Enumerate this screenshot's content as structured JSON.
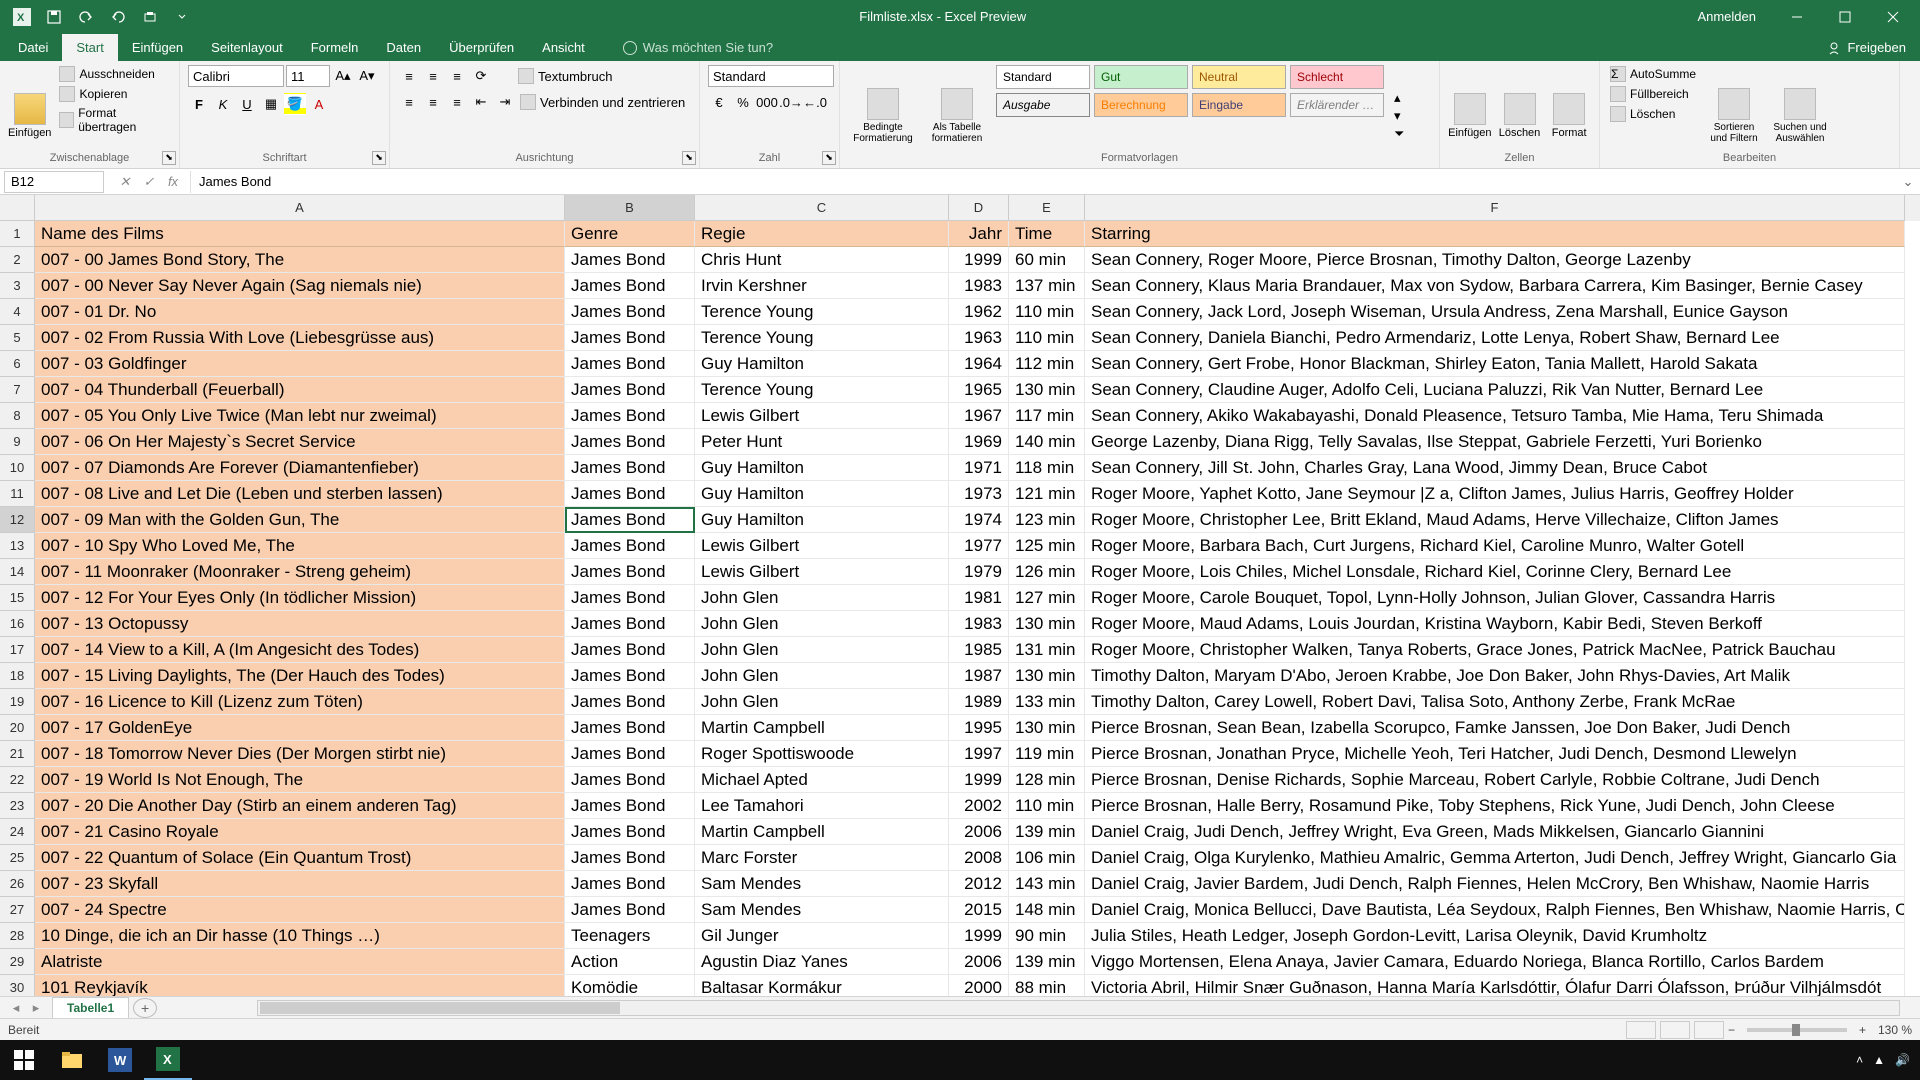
{
  "window": {
    "title": "Filmliste.xlsx - Excel Preview",
    "anmelden": "Anmelden"
  },
  "tabs": {
    "datei": "Datei",
    "start": "Start",
    "einfuegen": "Einfügen",
    "seitenlayout": "Seitenlayout",
    "formeln": "Formeln",
    "daten": "Daten",
    "ueberpruefen": "Überprüfen",
    "ansicht": "Ansicht",
    "tellme": "Was möchten Sie tun?",
    "freigeben": "Freigeben"
  },
  "ribbon": {
    "clipboard": {
      "label": "Zwischenablage",
      "paste": "Einfügen",
      "cut": "Ausschneiden",
      "copy": "Kopieren",
      "formatpainter": "Format übertragen"
    },
    "font": {
      "label": "Schriftart",
      "name": "Calibri",
      "size": "11"
    },
    "alignment": {
      "label": "Ausrichtung",
      "wrap": "Textumbruch",
      "merge": "Verbinden und zentrieren"
    },
    "number": {
      "label": "Zahl",
      "format": "Standard"
    },
    "styles": {
      "label": "Formatvorlagen",
      "conditional": "Bedingte Formatierung",
      "astable": "Als Tabelle formatieren",
      "standard": "Standard",
      "gut": "Gut",
      "neutral": "Neutral",
      "schlecht": "Schlecht",
      "ausgabe": "Ausgabe",
      "berechnung": "Berechnung",
      "eingabe": "Eingabe",
      "erklaerender": "Erklärender …"
    },
    "cells": {
      "label": "Zellen",
      "insert": "Einfügen",
      "delete": "Löschen",
      "format": "Format"
    },
    "editing": {
      "label": "Bearbeiten",
      "autosum": "AutoSumme",
      "fill": "Füllbereich",
      "clear": "Löschen",
      "sort": "Sortieren und Filtern",
      "find": "Suchen und Auswählen"
    }
  },
  "formula": {
    "namebox": "B12",
    "value": "James Bond"
  },
  "columns": [
    "A",
    "B",
    "C",
    "D",
    "E",
    "F"
  ],
  "headers": {
    "a": "Name des Films",
    "b": "Genre",
    "c": "Regie",
    "d": "Jahr",
    "e": "Time",
    "f": "Starring"
  },
  "rows": [
    {
      "n": 2,
      "a": "007 - 00 James Bond Story, The",
      "b": "James Bond",
      "c": "Chris Hunt",
      "d": "1999",
      "e": "60 min",
      "f": "Sean Connery, Roger Moore, Pierce Brosnan, Timothy Dalton, George Lazenby"
    },
    {
      "n": 3,
      "a": "007 - 00 Never Say Never Again (Sag niemals nie)",
      "b": "James Bond",
      "c": "Irvin Kershner",
      "d": "1983",
      "e": "137 min",
      "f": "Sean Connery, Klaus Maria Brandauer, Max von Sydow, Barbara Carrera, Kim Basinger, Bernie Casey"
    },
    {
      "n": 4,
      "a": "007 - 01 Dr. No",
      "b": "James Bond",
      "c": "Terence Young",
      "d": "1962",
      "e": "110 min",
      "f": "Sean Connery, Jack Lord, Joseph Wiseman, Ursula Andress, Zena Marshall, Eunice Gayson"
    },
    {
      "n": 5,
      "a": "007 - 02 From Russia With Love (Liebesgrüsse aus)",
      "b": "James Bond",
      "c": "Terence Young",
      "d": "1963",
      "e": "110 min",
      "f": "Sean Connery, Daniela Bianchi, Pedro Armendariz, Lotte Lenya, Robert Shaw, Bernard Lee"
    },
    {
      "n": 6,
      "a": "007 - 03 Goldfinger",
      "b": "James Bond",
      "c": "Guy Hamilton",
      "d": "1964",
      "e": "112 min",
      "f": "Sean Connery, Gert Frobe, Honor Blackman, Shirley Eaton, Tania Mallett, Harold Sakata"
    },
    {
      "n": 7,
      "a": "007 - 04 Thunderball (Feuerball)",
      "b": "James Bond",
      "c": "Terence Young",
      "d": "1965",
      "e": "130 min",
      "f": "Sean Connery, Claudine Auger, Adolfo Celi, Luciana Paluzzi, Rik Van Nutter, Bernard Lee"
    },
    {
      "n": 8,
      "a": "007 - 05 You Only Live Twice (Man lebt nur zweimal)",
      "b": "James Bond",
      "c": "Lewis Gilbert",
      "d": "1967",
      "e": "117 min",
      "f": "Sean Connery, Akiko Wakabayashi, Donald Pleasence, Tetsuro Tamba, Mie Hama, Teru Shimada"
    },
    {
      "n": 9,
      "a": "007 - 06 On Her Majesty`s Secret Service",
      "b": "James Bond",
      "c": "Peter Hunt",
      "d": "1969",
      "e": "140 min",
      "f": "George Lazenby, Diana Rigg, Telly Savalas, Ilse Steppat, Gabriele Ferzetti, Yuri Borienko"
    },
    {
      "n": 10,
      "a": "007 - 07 Diamonds Are Forever (Diamantenfieber)",
      "b": "James Bond",
      "c": "Guy Hamilton",
      "d": "1971",
      "e": "118 min",
      "f": "Sean Connery, Jill St. John, Charles Gray, Lana Wood, Jimmy Dean, Bruce Cabot"
    },
    {
      "n": 11,
      "a": "007 - 08 Live and Let Die (Leben und sterben lassen)",
      "b": "James Bond",
      "c": "Guy Hamilton",
      "d": "1973",
      "e": "121 min",
      "f": "Roger Moore, Yaphet Kotto, Jane Seymour |Z a, Clifton James, Julius Harris, Geoffrey Holder"
    },
    {
      "n": 12,
      "a": "007 - 09 Man with the Golden Gun, The",
      "b": "James Bond",
      "c": "Guy Hamilton",
      "d": "1974",
      "e": "123 min",
      "f": "Roger Moore, Christopher Lee, Britt Ekland, Maud Adams, Herve Villechaize, Clifton James"
    },
    {
      "n": 13,
      "a": "007 - 10 Spy Who Loved Me, The",
      "b": "James Bond",
      "c": "Lewis Gilbert",
      "d": "1977",
      "e": "125 min",
      "f": "Roger Moore, Barbara Bach, Curt Jurgens, Richard Kiel, Caroline Munro, Walter Gotell"
    },
    {
      "n": 14,
      "a": "007 - 11 Moonraker (Moonraker - Streng geheim)",
      "b": "James Bond",
      "c": "Lewis Gilbert",
      "d": "1979",
      "e": "126 min",
      "f": "Roger Moore, Lois Chiles, Michel Lonsdale, Richard Kiel, Corinne Clery, Bernard Lee"
    },
    {
      "n": 15,
      "a": "007 - 12 For Your Eyes Only (In tödlicher Mission)",
      "b": "James Bond",
      "c": "John Glen",
      "d": "1981",
      "e": "127 min",
      "f": "Roger Moore, Carole Bouquet, Topol, Lynn-Holly Johnson, Julian Glover, Cassandra Harris"
    },
    {
      "n": 16,
      "a": "007 - 13 Octopussy",
      "b": "James Bond",
      "c": "John Glen",
      "d": "1983",
      "e": "130 min",
      "f": "Roger Moore, Maud Adams, Louis Jourdan, Kristina Wayborn, Kabir Bedi, Steven Berkoff"
    },
    {
      "n": 17,
      "a": "007 - 14 View to a Kill, A (Im Angesicht des Todes)",
      "b": "James Bond",
      "c": "John Glen",
      "d": "1985",
      "e": "131 min",
      "f": "Roger Moore, Christopher Walken, Tanya Roberts, Grace Jones, Patrick MacNee, Patrick Bauchau"
    },
    {
      "n": 18,
      "a": "007 - 15 Living Daylights, The (Der Hauch des Todes)",
      "b": "James Bond",
      "c": "John Glen",
      "d": "1987",
      "e": "130 min",
      "f": "Timothy Dalton, Maryam D'Abo, Jeroen Krabbe, Joe Don Baker, John Rhys-Davies, Art Malik"
    },
    {
      "n": 19,
      "a": "007 - 16 Licence to Kill (Lizenz zum Töten)",
      "b": "James Bond",
      "c": "John Glen",
      "d": "1989",
      "e": "133 min",
      "f": "Timothy Dalton, Carey Lowell, Robert Davi, Talisa Soto, Anthony Zerbe, Frank McRae"
    },
    {
      "n": 20,
      "a": "007 - 17 GoldenEye",
      "b": "James Bond",
      "c": "Martin Campbell",
      "d": "1995",
      "e": "130 min",
      "f": "Pierce Brosnan, Sean Bean, Izabella Scorupco, Famke Janssen, Joe Don Baker, Judi Dench"
    },
    {
      "n": 21,
      "a": "007 - 18 Tomorrow Never Dies (Der Morgen stirbt nie)",
      "b": "James Bond",
      "c": "Roger Spottiswoode",
      "d": "1997",
      "e": "119 min",
      "f": "Pierce Brosnan, Jonathan Pryce, Michelle Yeoh, Teri Hatcher, Judi Dench, Desmond Llewelyn"
    },
    {
      "n": 22,
      "a": "007 - 19 World Is Not Enough, The",
      "b": "James Bond",
      "c": "Michael Apted",
      "d": "1999",
      "e": "128 min",
      "f": "Pierce Brosnan, Denise Richards, Sophie Marceau, Robert Carlyle, Robbie Coltrane, Judi Dench"
    },
    {
      "n": 23,
      "a": "007 - 20 Die Another Day (Stirb an einem anderen Tag)",
      "b": "James Bond",
      "c": "Lee Tamahori",
      "d": "2002",
      "e": "110 min",
      "f": "Pierce Brosnan, Halle Berry, Rosamund Pike, Toby Stephens, Rick Yune, Judi Dench, John Cleese"
    },
    {
      "n": 24,
      "a": "007 - 21 Casino Royale",
      "b": "James Bond",
      "c": "Martin Campbell",
      "d": "2006",
      "e": "139 min",
      "f": "Daniel Craig, Judi Dench, Jeffrey Wright, Eva Green, Mads Mikkelsen, Giancarlo Giannini"
    },
    {
      "n": 25,
      "a": "007 - 22 Quantum of Solace (Ein Quantum Trost)",
      "b": "James Bond",
      "c": "Marc Forster",
      "d": "2008",
      "e": "106 min",
      "f": "Daniel Craig, Olga Kurylenko, Mathieu Amalric, Gemma Arterton, Judi Dench, Jeffrey Wright, Giancarlo Gia"
    },
    {
      "n": 26,
      "a": "007 - 23 Skyfall",
      "b": "James Bond",
      "c": "Sam Mendes",
      "d": "2012",
      "e": "143 min",
      "f": "Daniel Craig, Javier Bardem, Judi Dench, Ralph Fiennes, Helen McCrory, Ben Whishaw, Naomie Harris"
    },
    {
      "n": 27,
      "a": "007 - 24 Spectre",
      "b": "James Bond",
      "c": "Sam Mendes",
      "d": "2015",
      "e": "148 min",
      "f": "Daniel Craig, Monica Bellucci, Dave Bautista, Léa Seydoux, Ralph Fiennes, Ben Whishaw, Naomie Harris, Ch"
    },
    {
      "n": 28,
      "a": "10 Dinge, die ich an Dir hasse (10 Things …)",
      "b": "Teenagers",
      "c": "Gil Junger",
      "d": "1999",
      "e": "90 min",
      "f": "Julia Stiles, Heath Ledger, Joseph Gordon-Levitt, Larisa Oleynik, David Krumholtz"
    },
    {
      "n": 29,
      "a": "Alatriste",
      "b": "Action",
      "c": "Agustin Diaz Yanes",
      "d": "2006",
      "e": "139 min",
      "f": "Viggo Mortensen, Elena Anaya, Javier Camara, Eduardo Noriega, Blanca Rortillo, Carlos Bardem"
    },
    {
      "n": 30,
      "a": "101 Reykjavík",
      "b": "Komödie",
      "c": "Baltasar Kormákur",
      "d": "2000",
      "e": "88 min",
      "f": "Victoria Abril, Hilmir Snær Guðnason, Hanna María Karlsdóttir, Ólafur Darri Ólafsson, Þrúður Vilhjálmsdót"
    }
  ],
  "sheet": {
    "tab1": "Tabelle1"
  },
  "status": {
    "ready": "Bereit",
    "zoom": "130 %"
  }
}
